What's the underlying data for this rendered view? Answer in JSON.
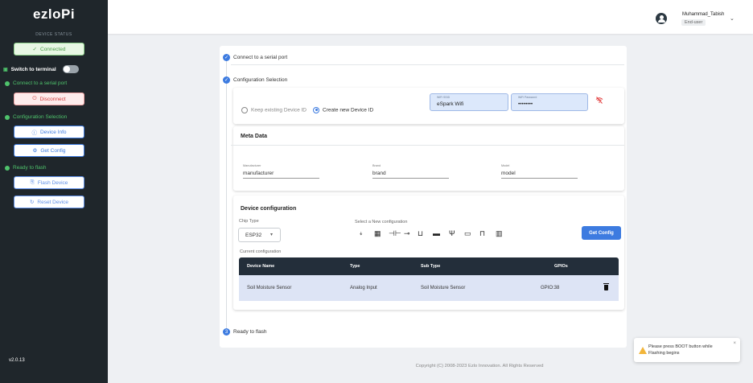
{
  "sidebar": {
    "logo": "ezloPi",
    "status_label": "DEVICE STATUS",
    "connected_label": "Connected",
    "terminal_label": "Switch to terminal",
    "step_serial": "Connect to a serial port",
    "disconnect_label": "Disconnect",
    "step_config": "Configuration Selection",
    "device_info_label": "Device Info",
    "get_config_label": "Get Config",
    "step_flash": "Ready to flash",
    "flash_device_label": "Flash Device",
    "reset_device_label": "Reset Device",
    "version": "v2.0.13"
  },
  "header": {
    "user_name": "Muhammad_Tabish",
    "user_role": "End-user"
  },
  "steps": {
    "serial": "Connect to a serial port",
    "config": "Configuration Selection",
    "flash": "Ready to flash",
    "flash_number": "3"
  },
  "device_id": {
    "keep_label": "Keep existing Device ID",
    "create_label": "Create new Device ID",
    "selected": "create"
  },
  "wifi": {
    "ssid_label": "WiFi SSID",
    "ssid_value": "eSpark Wifi",
    "password_label": "WiFi Password",
    "password_value": "••••••••"
  },
  "meta": {
    "title": "Meta Data",
    "manufacturer_label": "Manufacturer",
    "manufacturer_value": "manufacturer",
    "brand_label": "Brand",
    "brand_value": "brand",
    "model_label": "Model",
    "model_value": "model"
  },
  "device_config": {
    "title": "Device configuration",
    "chip_type_label": "Chip Type",
    "chip_type_value": "ESP32",
    "select_new_label": "Select a New configuration",
    "get_config_button": "Get Config",
    "current_label": "Current configuration",
    "columns": [
      "Device Name",
      "Type",
      "Sub Type",
      "GPIOs"
    ],
    "rows": [
      {
        "device_name": "Soil Moisture Sensor",
        "type": "Analog Input",
        "sub_type": "Soil Moisture Sensor",
        "gpios": "GPIO:38"
      }
    ]
  },
  "footer": "Copyright (C) 2008-2023 Ezlo Innovation. All Rights Reserved",
  "toast": {
    "message": "Please press BOOT button while Flashing begins"
  },
  "colors": {
    "accent": "#3d7be0",
    "sidebar_bg": "#1f262b",
    "success": "#4fc36c",
    "danger": "#d23c3c",
    "table_header": "#232e3a",
    "warning": "#f2b53a"
  }
}
